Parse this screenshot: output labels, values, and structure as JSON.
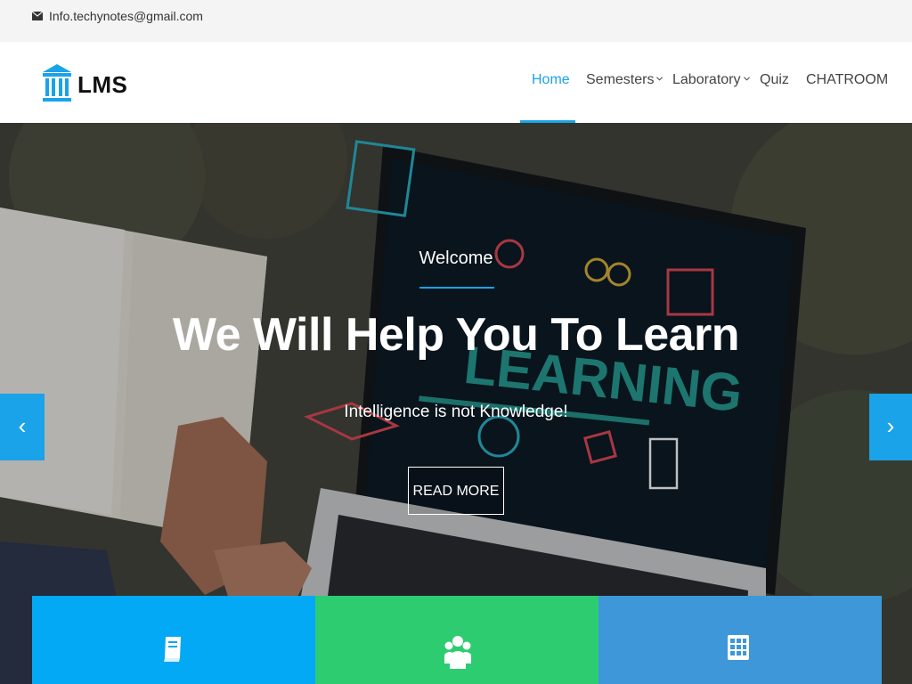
{
  "topbar": {
    "email": "Info.techynotes@gmail.com",
    "icon": "envelope-icon"
  },
  "header": {
    "logo_text": "LMS",
    "logo_icon": "institution-icon",
    "nav": [
      {
        "label": "Home",
        "active": true,
        "dropdown": false
      },
      {
        "label": "Semesters",
        "active": false,
        "dropdown": true
      },
      {
        "label": "Laboratory",
        "active": false,
        "dropdown": true
      },
      {
        "label": "Quiz",
        "active": false,
        "dropdown": false
      },
      {
        "label": "CHATROOM",
        "active": false,
        "dropdown": false
      }
    ]
  },
  "hero": {
    "welcome": "Welcome",
    "title": "We Will Help You To Learn",
    "subtitle": "Intelligence is not Knowledge!",
    "button": "READ MORE",
    "prev_arrow": "‹",
    "next_arrow": "›"
  },
  "features": [
    {
      "icon": "book-icon",
      "color": "#03a9f4"
    },
    {
      "icon": "users-icon",
      "color": "#2ecc71"
    },
    {
      "icon": "calendar-icon",
      "color": "#3e97d8"
    }
  ],
  "colors": {
    "accent": "#1aa3e8"
  }
}
